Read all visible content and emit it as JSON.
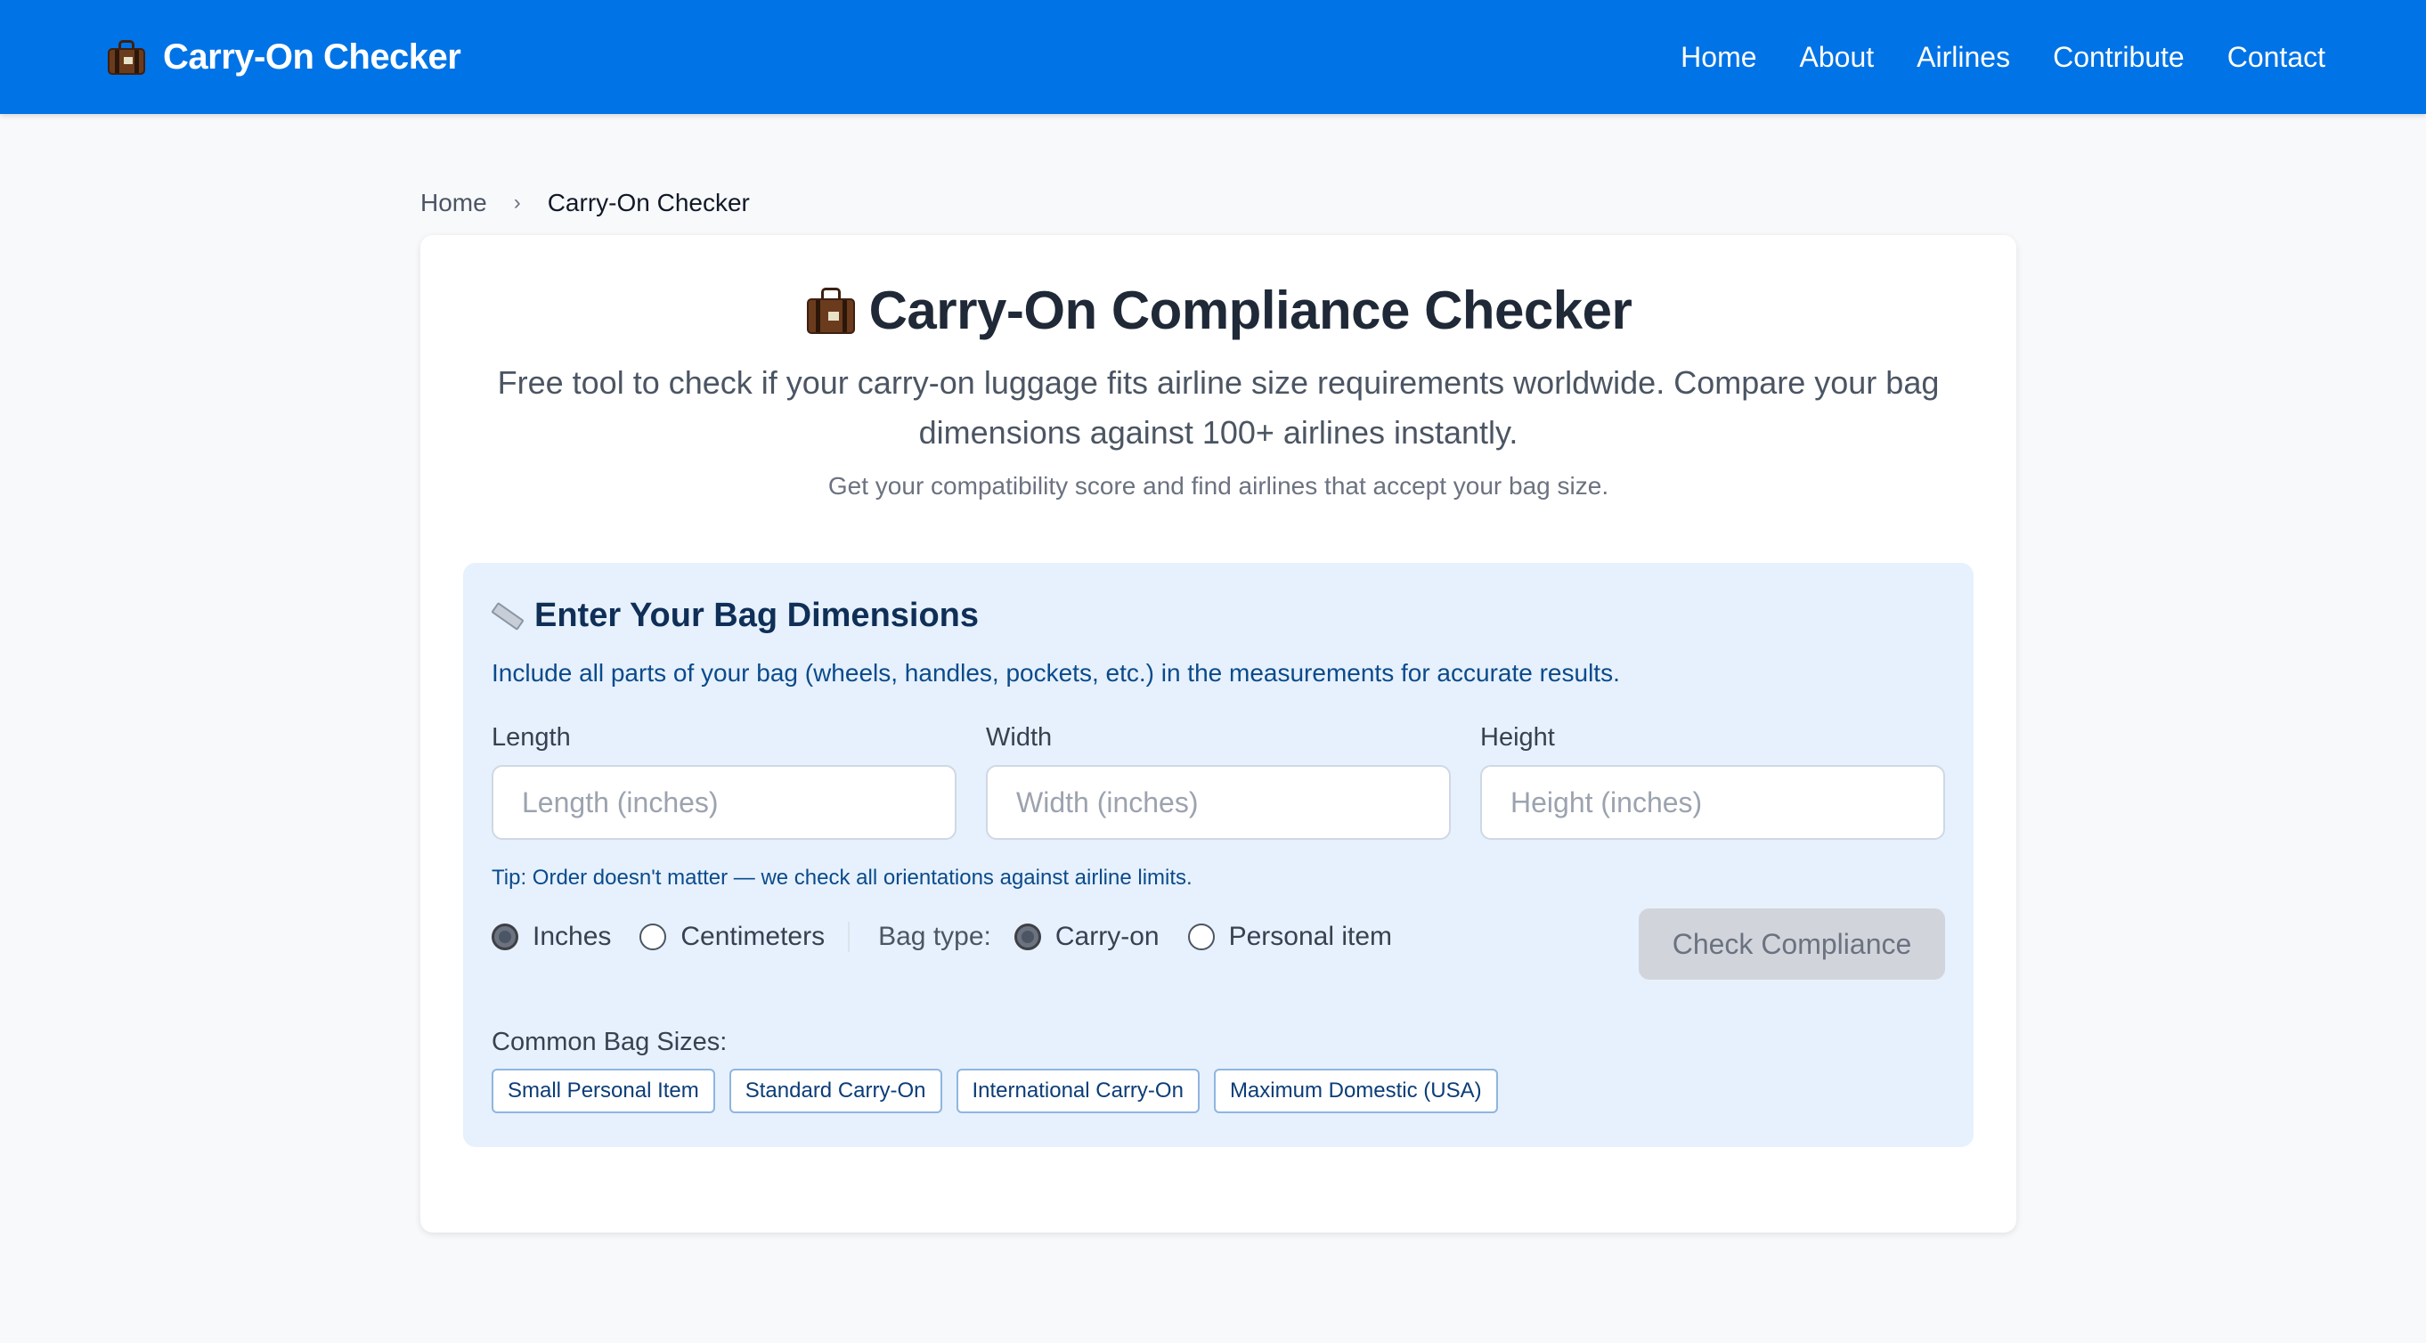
{
  "header": {
    "brand": "Carry-On Checker",
    "nav": [
      "Home",
      "About",
      "Airlines",
      "Contribute",
      "Contact"
    ]
  },
  "breadcrumb": {
    "home": "Home",
    "separator": "›",
    "current": "Carry-On Checker"
  },
  "hero": {
    "title": "Carry-On Compliance Checker",
    "lead": "Free tool to check if your carry-on luggage fits airline size requirements worldwide. Compare your bag dimensions against 100+ airlines instantly.",
    "sublead": "Get your compatibility score and find airlines that accept your bag size."
  },
  "form": {
    "title": "Enter Your Bag Dimensions",
    "hint": "Include all parts of your bag (wheels, handles, pockets, etc.) in the measurements for accurate results.",
    "fields": {
      "length": {
        "label": "Length",
        "placeholder": "Length (inches)"
      },
      "width": {
        "label": "Width",
        "placeholder": "Width (inches)"
      },
      "height": {
        "label": "Height",
        "placeholder": "Height (inches)"
      }
    },
    "tip": "Tip: Order doesn't matter — we check all orientations against airline limits.",
    "units": {
      "inches": "Inches",
      "centimeters": "Centimeters",
      "selected": "Inches"
    },
    "bag_type": {
      "label": "Bag type:",
      "carry_on": "Carry-on",
      "personal_item": "Personal item",
      "selected": "Carry-on"
    },
    "submit_label": "Check Compliance",
    "common_label": "Common Bag Sizes:",
    "presets": [
      "Small Personal Item",
      "Standard Carry-On",
      "International Carry-On",
      "Maximum Domestic (USA)"
    ]
  },
  "icons": {
    "brand": "suitcase-icon",
    "title": "suitcase-icon",
    "form": "ruler-icon"
  },
  "colors": {
    "header_bg": "#0073e6",
    "panel_bg": "#e6f1fd",
    "button_disabled": "#d1d5db"
  }
}
